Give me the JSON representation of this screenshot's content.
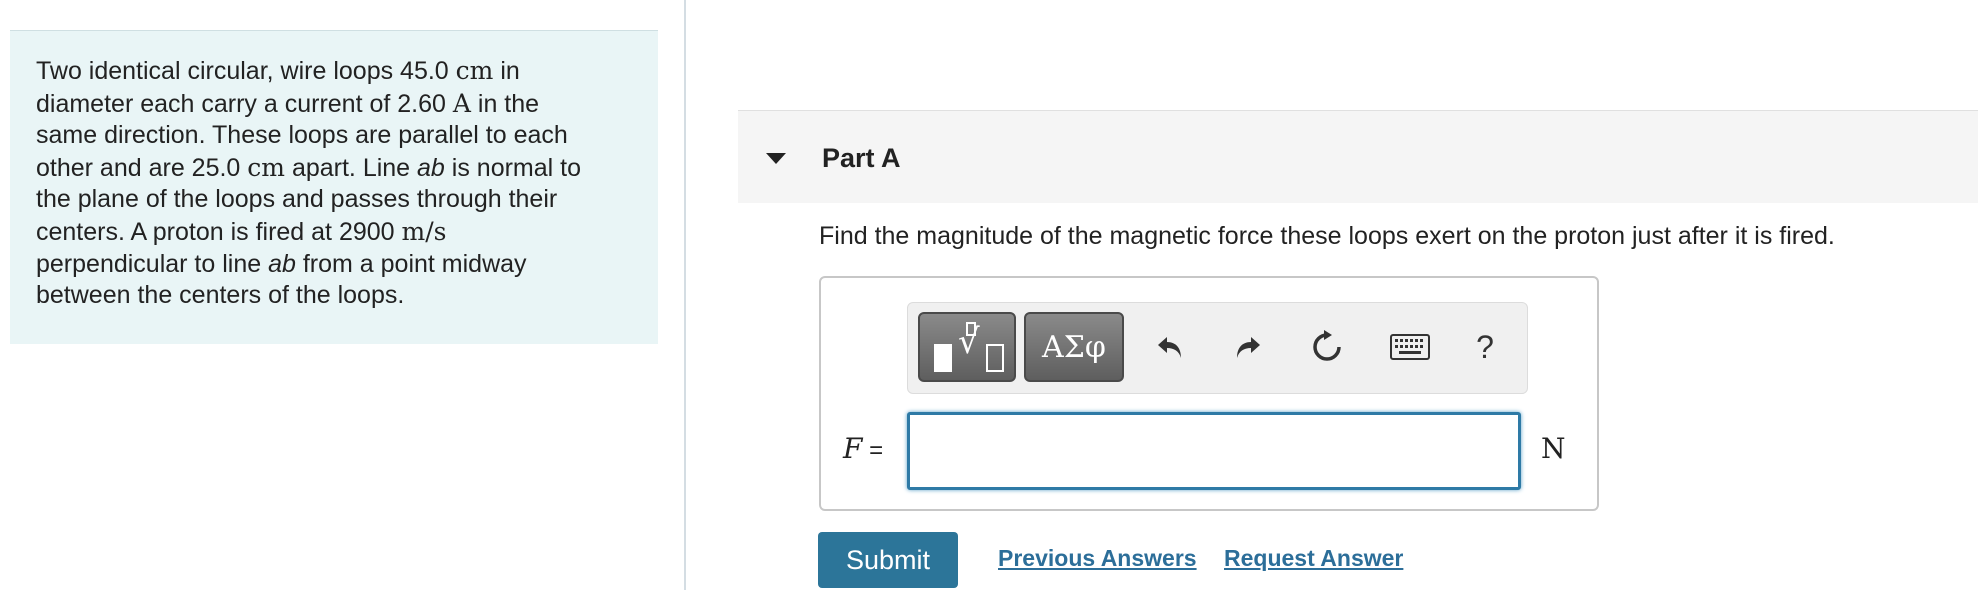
{
  "problem": {
    "lines": [
      [
        "Two identical circular, wire loops 45.0 ",
        {
          "m": "cm"
        },
        " in"
      ],
      [
        "diameter each carry a current of 2.60 ",
        {
          "m": "A"
        },
        " in the"
      ],
      [
        "same direction. These loops are parallel to each"
      ],
      [
        "other and are 25.0 ",
        {
          "m": "cm"
        },
        " apart. Line ",
        {
          "i": "ab"
        },
        " is normal to"
      ],
      [
        "the plane of the loops and passes through their"
      ],
      [
        "centers. A proton is fired at 2900 ",
        {
          "m": "m/s"
        }
      ],
      [
        "perpendicular to line ",
        {
          "i": "ab"
        },
        " from a point midway"
      ],
      [
        "between the centers of the loops."
      ]
    ]
  },
  "part": {
    "title": "Part A",
    "question": "Find the magnitude of the magnetic force these loops exert on the proton just after it is fired."
  },
  "toolbar": {
    "greek_label": "ΑΣφ",
    "help_label": "?",
    "icons": [
      "templates-icon",
      "undo-icon",
      "redo-icon",
      "reset-icon",
      "keyboard-icon",
      "help-icon"
    ]
  },
  "answer": {
    "variable": "F",
    "equals": " =",
    "value": "",
    "unit": "N"
  },
  "actions": {
    "submit_label": "Submit",
    "previous_answers_label": "Previous Answers",
    "request_answer_label": "Request Answer"
  },
  "colors": {
    "problem_bg": "#e9f5f6",
    "submit_bg": "#2c7599",
    "link": "#2c6e99",
    "input_border": "#2e7aa6"
  }
}
